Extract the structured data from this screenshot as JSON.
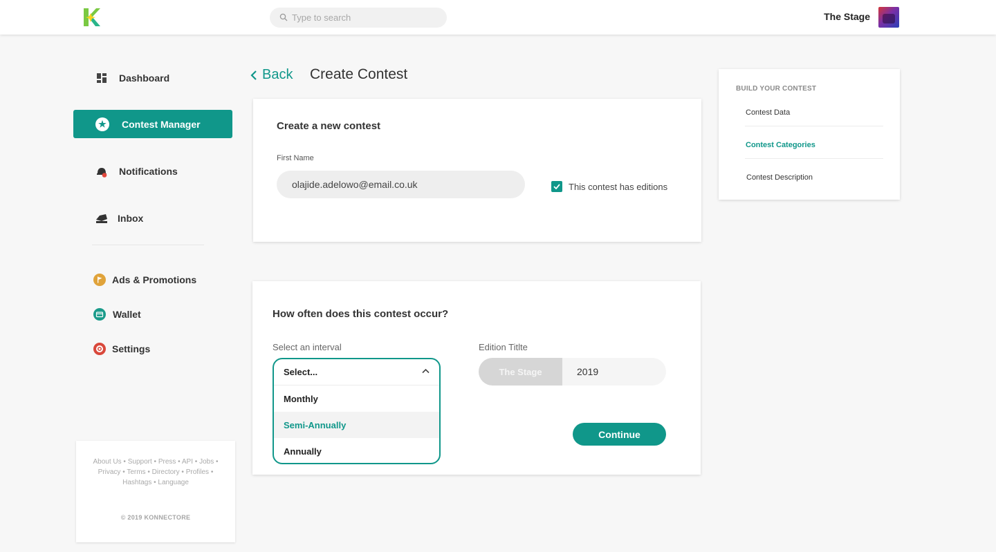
{
  "topbar": {
    "search_placeholder": "Type to search",
    "user_name": "The Stage"
  },
  "sidebar": {
    "items": [
      {
        "label": "Dashboard",
        "icon": "dashboard-icon"
      },
      {
        "label": "Contest Manager",
        "icon": "star-icon",
        "active": true
      },
      {
        "label": "Notifications",
        "icon": "bell-icon"
      },
      {
        "label": "Inbox",
        "icon": "inbox-icon"
      },
      {
        "label": "Ads & Promotions",
        "icon": "flag-icon"
      },
      {
        "label": "Wallet",
        "icon": "wallet-icon"
      },
      {
        "label": "Settings",
        "icon": "gear-icon"
      }
    ],
    "footer": {
      "links": [
        "About Us",
        "Support",
        "Press",
        "API",
        "Jobs",
        "Privacy",
        "Terms",
        "Directory",
        "Profiles",
        "Hashtags",
        "Language"
      ],
      "copyright": "© 2019 KONNECTORE"
    }
  },
  "header": {
    "back_label": "Back",
    "title": "Create Contest"
  },
  "form1": {
    "title": "Create a new contest",
    "first_name_label": "First Name",
    "first_name_value": "olajide.adelowo@email.co.uk",
    "editions_checkbox_label": "This contest has editions",
    "editions_checked": true
  },
  "form2": {
    "title": "How often does this contest occur?",
    "interval_label": "Select an interval",
    "interval_selected": "Select...",
    "interval_options": [
      "Monthly",
      "Semi-Annually",
      "Annually"
    ],
    "highlighted_option": "Semi-Annually",
    "edition_title_label": "Edition Titlte",
    "edition_prefix": "The Stage",
    "edition_value": "2019",
    "continue_label": "Continue"
  },
  "build": {
    "title": "BUILD YOUR CONTEST",
    "steps": [
      "Contest Data",
      "Contest Categories",
      "Contest Description"
    ],
    "active_step": "Contest Categories"
  },
  "colors": {
    "accent": "#10978a",
    "background": "#f7f7f7"
  }
}
